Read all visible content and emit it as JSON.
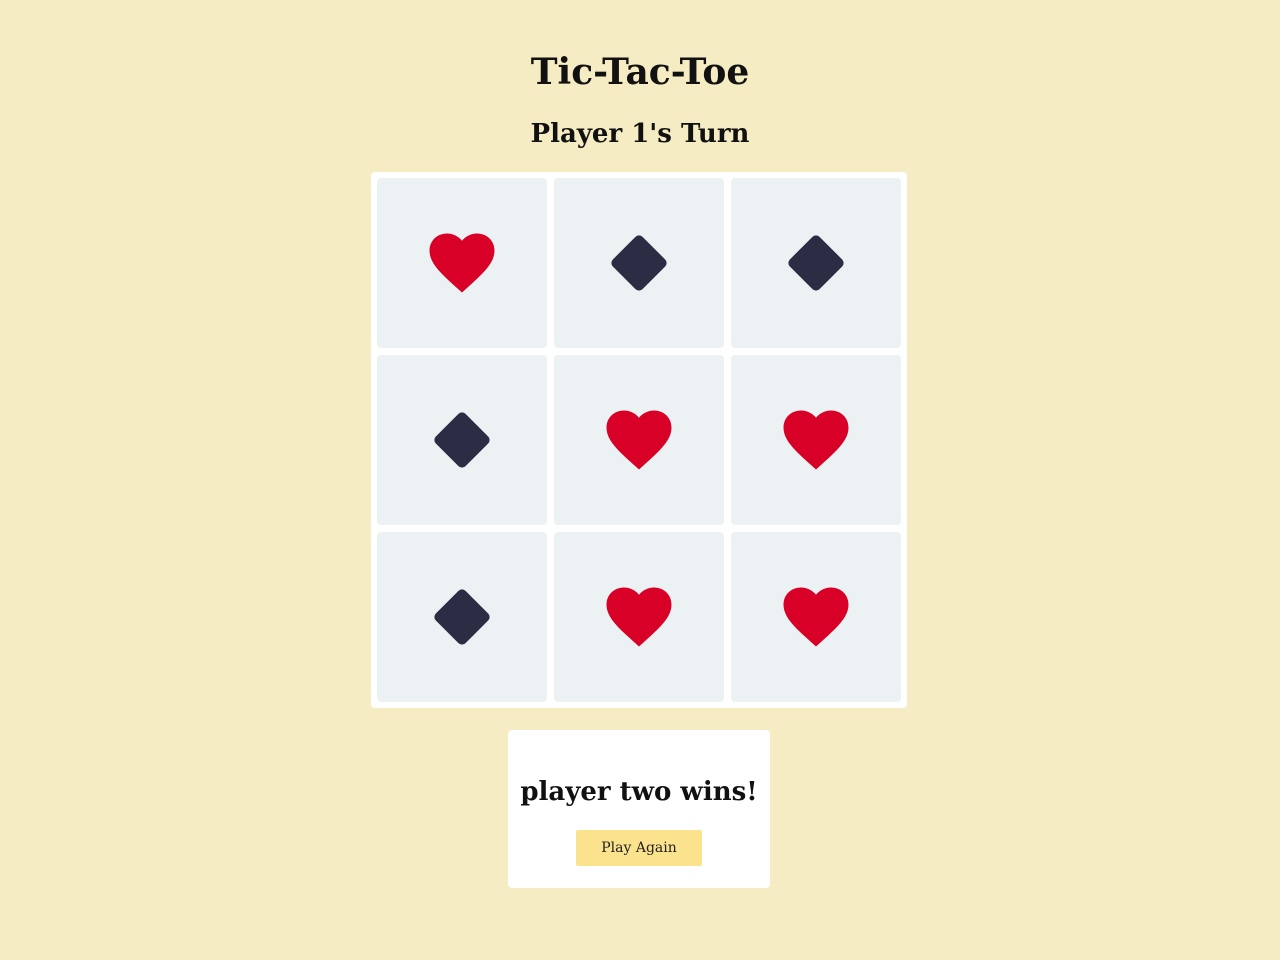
{
  "header": {
    "title": "Tic-Tac-Toe",
    "turn_text": "Player 1's Turn"
  },
  "board": {
    "cells": [
      {
        "mark": "heart-icon"
      },
      {
        "mark": "diamond-icon"
      },
      {
        "mark": "diamond-icon"
      },
      {
        "mark": "diamond-icon"
      },
      {
        "mark": "heart-icon"
      },
      {
        "mark": "heart-icon"
      },
      {
        "mark": "diamond-icon"
      },
      {
        "mark": "heart-icon"
      },
      {
        "mark": "heart-icon"
      }
    ]
  },
  "result": {
    "message": "player two wins!",
    "play_again_label": "Play Again"
  },
  "colors": {
    "background": "#f6ecc3",
    "heart": "#d80027",
    "diamond": "#2a2d43",
    "cell": "#ecf1f4",
    "button": "#fbe38d"
  }
}
